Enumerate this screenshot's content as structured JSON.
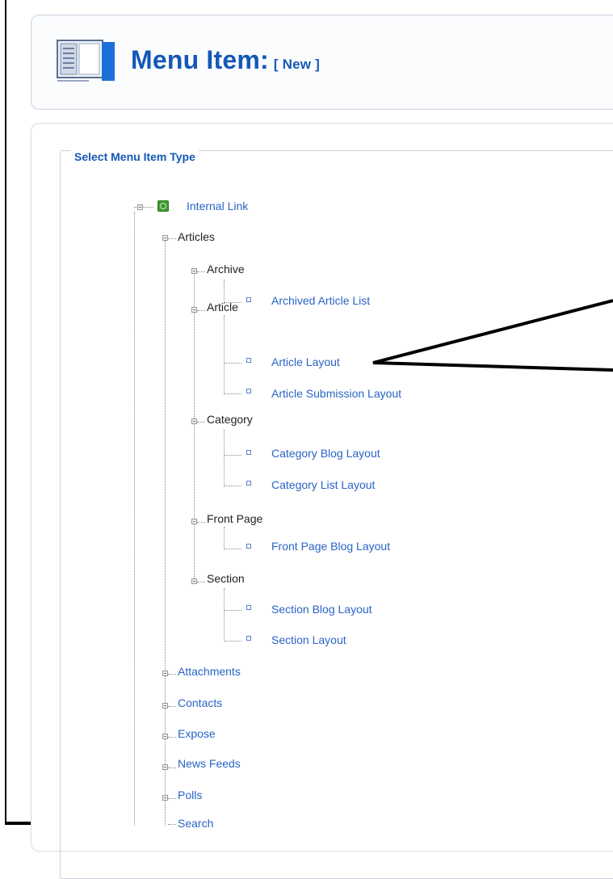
{
  "header": {
    "title": "Menu Item:",
    "subtitle": "[ New ]",
    "icon": "menu-icon"
  },
  "panel": {
    "legend": "Select Menu Item Type"
  },
  "tree": {
    "root": {
      "label": "Internal Link",
      "icon": "globe-icon"
    },
    "articles": {
      "label": "Articles"
    },
    "archive": {
      "label": "Archive"
    },
    "archived_article_list": {
      "label": "Archived Article List"
    },
    "article": {
      "label": "Article"
    },
    "article_layout": {
      "label": "Article Layout"
    },
    "article_submission_layout": {
      "label": "Article Submission Layout"
    },
    "category": {
      "label": "Category"
    },
    "category_blog_layout": {
      "label": "Category Blog Layout"
    },
    "category_list_layout": {
      "label": "Category List Layout"
    },
    "front_page": {
      "label": "Front Page"
    },
    "front_page_blog_layout": {
      "label": "Front Page Blog Layout"
    },
    "section": {
      "label": "Section"
    },
    "section_blog_layout": {
      "label": "Section Blog Layout"
    },
    "section_layout": {
      "label": "Section Layout"
    },
    "attachments": {
      "label": "Attachments"
    },
    "contacts": {
      "label": "Contacts"
    },
    "expose": {
      "label": "Expose"
    },
    "news_feeds": {
      "label": "News Feeds"
    },
    "polls": {
      "label": "Polls"
    },
    "search": {
      "label": "Search"
    }
  },
  "colors": {
    "title_blue": "#1458b7",
    "link_blue": "#2a64c6",
    "callout": "#000000"
  }
}
